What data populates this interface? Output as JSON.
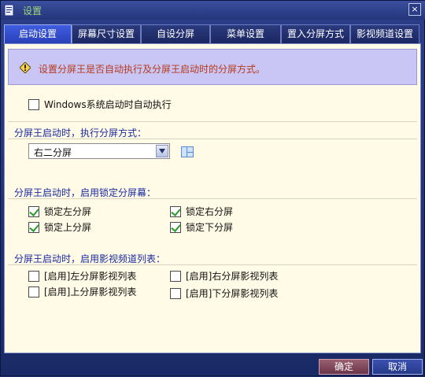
{
  "window": {
    "title": "设置",
    "close_label": "×"
  },
  "tabs": [
    {
      "label": "启动设置",
      "active": true
    },
    {
      "label": "屏幕尺寸设置",
      "active": false
    },
    {
      "label": "自设分屏",
      "active": false
    },
    {
      "label": "菜单设置",
      "active": false
    },
    {
      "label": "置入分屏方式",
      "active": false
    },
    {
      "label": "影视频道设置",
      "active": false
    }
  ],
  "info": {
    "text": "设置分屏王是否自动执行及分屏王启动时的分屏方式。"
  },
  "autostart": {
    "label": "Windows系统启动时自动执行",
    "checked": false
  },
  "split_mode": {
    "heading": "分屏王启动时，执行分屏方式：",
    "selected": "右二分屏"
  },
  "lock_screens": {
    "heading": "分屏王启动时，启用锁定分屏幕：",
    "items": [
      {
        "label": "锁定左分屏",
        "checked": true
      },
      {
        "label": "锁定右分屏",
        "checked": true
      },
      {
        "label": "锁定上分屏",
        "checked": true
      },
      {
        "label": "锁定下分屏",
        "checked": true
      }
    ]
  },
  "video_lists": {
    "heading": "分屏王启动时，启用影视频道列表：",
    "items": [
      {
        "label": "[启用]左分屏影视列表",
        "checked": false
      },
      {
        "label": "[启用]右分屏影视列表",
        "checked": false
      },
      {
        "label": "[启用]上分屏影视列表",
        "checked": false
      },
      {
        "label": "[启用]下分屏影视列表",
        "checked": false
      }
    ]
  },
  "footer": {
    "ok_label": "确定",
    "cancel_label": "取消"
  },
  "colors": {
    "accent": "#2941b8",
    "heading": "#1a2aa0",
    "info_text": "#b63a1a",
    "check": "#2a9b2a"
  }
}
